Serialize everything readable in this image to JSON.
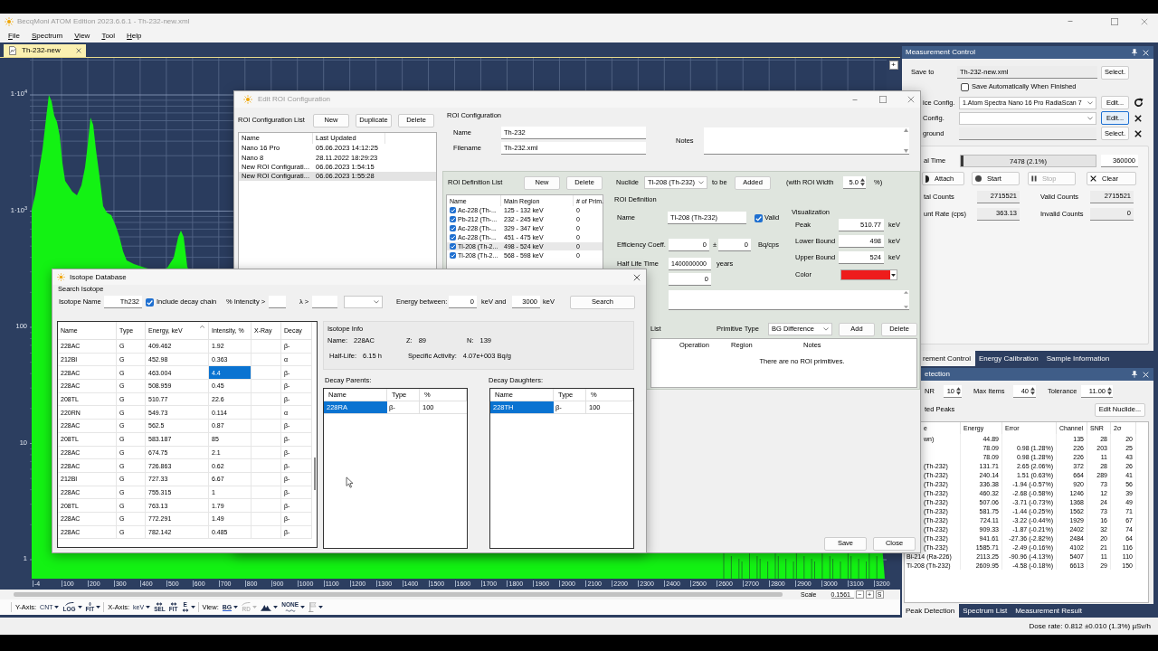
{
  "window": {
    "title": "BecqMoni ATOM Edition 2023.6.6.1 - Th-232-new.xml"
  },
  "menu": [
    {
      "label": "File"
    },
    {
      "label": "Spectrum"
    },
    {
      "label": "View"
    },
    {
      "label": "Tool"
    },
    {
      "label": "Help"
    }
  ],
  "document_tabs": [
    {
      "label": "Th-232-new",
      "selected": true
    }
  ],
  "spectrum": {
    "y_labels": [
      "1·10$^{4}$",
      "1·10$^{3}$",
      "100",
      "10",
      "1"
    ],
    "x_labels": [
      "-4",
      "100",
      "200",
      "300",
      "400",
      "500",
      "600",
      "700",
      "800",
      "900",
      "1000",
      "1100",
      "1200",
      "1300",
      "1400",
      "1500",
      "1600",
      "1700",
      "1800",
      "1900",
      "2000",
      "2100",
      "2200",
      "2300",
      "2400",
      "2500",
      "2600",
      "2700",
      "2800",
      "2900",
      "3000",
      "3100",
      "3200"
    ],
    "zoom_button": "+"
  },
  "roi_dialog": {
    "title": "Edit ROI Configuration",
    "config_list": {
      "label": "ROI Configuration List",
      "buttons": [
        "New",
        "Duplicate",
        "Delete"
      ],
      "columns": [
        "Name",
        "Last Updated"
      ],
      "rows": [
        {
          "name": "Nano 16 Pro",
          "updated": "05.06.2023 14:12:25",
          "selected": false
        },
        {
          "name": "Nano 8",
          "updated": "28.11.2022 18:29:23",
          "selected": false
        },
        {
          "name": "New ROI Configurati...",
          "updated": "06.06.2023 1:54:15",
          "selected": false
        },
        {
          "name": "New ROI Configurati...",
          "updated": "06.06.2023 1:55:28",
          "selected": true
        }
      ]
    },
    "configuration": {
      "label": "ROI Configuration",
      "fields": [
        {
          "label": "Name",
          "value": "Th-232"
        },
        {
          "label": "Filename",
          "value": "Th-232.xml"
        }
      ],
      "notes_label": "Notes"
    },
    "definition_list": {
      "label": "ROI Definition List",
      "buttons": [
        "New",
        "Delete"
      ],
      "columns": [
        "Name",
        "Main Region",
        "# of Prim."
      ],
      "rows": [
        {
          "name": "Ac-228 (Th-...",
          "region": "125 - 132 keV",
          "primitives": "0",
          "checked": true,
          "selected": false
        },
        {
          "name": "Pb-212 (Th-...",
          "region": "232 - 245 keV",
          "primitives": "0",
          "checked": true,
          "selected": false
        },
        {
          "name": "Ac-228 (Th-...",
          "region": "329 - 347 keV",
          "primitives": "0",
          "checked": true,
          "selected": false
        },
        {
          "name": "Ac-228 (Th-...",
          "region": "451 - 475 keV",
          "primitives": "0",
          "checked": true,
          "selected": false
        },
        {
          "name": "Tl-208 (Th-2...",
          "region": "498 - 524 keV",
          "primitives": "0",
          "checked": true,
          "selected": true
        },
        {
          "name": "Tl-208 (Th-2...",
          "region": "568 - 598 keV",
          "primitives": "0",
          "checked": true,
          "selected": false
        }
      ]
    },
    "nuclide": {
      "label": "Nuclide",
      "value": "Tl-208 (Th-232)",
      "to_be": "to be",
      "button": "Added",
      "width_label": "(with ROI Width",
      "width_value": "5.0",
      "width_unit": "%)"
    },
    "definition": {
      "label": "ROI Definition",
      "name_label": "Name",
      "name_value": "Tl-208 (Th-232)",
      "valid": {
        "label": "Valid",
        "checked": true
      },
      "efficiency": {
        "label": "Efficiency Coeff.",
        "value": "0",
        "pm": "±",
        "error": "0",
        "unit": "Bq/cps"
      },
      "half_life": {
        "label": "Half Life Time",
        "value": "1400000000",
        "unit": "years"
      },
      "extra_value": "0"
    },
    "visualization": {
      "label": "Visualization",
      "fields": [
        {
          "label": "Peak",
          "value": "510.77",
          "unit": "keV"
        },
        {
          "label": "Lower Bound",
          "value": "498",
          "unit": "keV"
        },
        {
          "label": "Upper Bound",
          "value": "524",
          "unit": "keV"
        }
      ],
      "color": {
        "label": "Color",
        "color": "#ee1c1c"
      }
    },
    "primitives": {
      "label": "List",
      "type_label": "Primitive Type",
      "type_value": "BG Difference",
      "buttons": [
        "Add",
        "Delete"
      ],
      "columns": [
        "Operation",
        "Region",
        "Notes"
      ],
      "empty": "There are no ROI primitives."
    },
    "footer_buttons": [
      "Save",
      "Close"
    ]
  },
  "isotope_dialog": {
    "title": "Isotope Database",
    "search": {
      "label": "Search Isotope",
      "name_label": "Isotope Name",
      "name_value": "Th232",
      "include_chain": {
        "label": "Include decay chain",
        "checked": true
      },
      "intensity_label": "% Intencity >",
      "lambda_label": "λ >",
      "energy_label": "Energy between:",
      "energy_from": "0",
      "and_label": "keV and",
      "energy_to": "3000",
      "unit": "keV",
      "button": "Search"
    },
    "table": {
      "columns": [
        {
          "label": "Name",
          "sorted": false
        },
        {
          "label": "Type",
          "sorted": false
        },
        {
          "label": "Energy, keV",
          "sorted": true
        },
        {
          "label": "Intensity, %",
          "sorted": false
        },
        {
          "label": "X-Ray",
          "sorted": false
        },
        {
          "label": "Decay",
          "sorted": false
        }
      ],
      "rows": [
        {
          "name": "228AC",
          "type": "G",
          "energy": "409.462",
          "intensity": "1.92",
          "decay": "β-",
          "selected": false
        },
        {
          "name": "212BI",
          "type": "G",
          "energy": "452.98",
          "intensity": "0.363",
          "decay": "α",
          "selected": false
        },
        {
          "name": "228AC",
          "type": "G",
          "energy": "463.004",
          "intensity": "4.4",
          "decay": "β-",
          "selected": true
        },
        {
          "name": "228AC",
          "type": "G",
          "energy": "508.959",
          "intensity": "0.45",
          "decay": "β-",
          "selected": false
        },
        {
          "name": "208TL",
          "type": "G",
          "energy": "510.77",
          "intensity": "22.6",
          "decay": "β-",
          "selected": false
        },
        {
          "name": "220RN",
          "type": "G",
          "energy": "549.73",
          "intensity": "0.114",
          "decay": "α",
          "selected": false
        },
        {
          "name": "228AC",
          "type": "G",
          "energy": "562.5",
          "intensity": "0.87",
          "decay": "β-",
          "selected": false
        },
        {
          "name": "208TL",
          "type": "G",
          "energy": "583.187",
          "intensity": "85",
          "decay": "β-",
          "selected": false
        },
        {
          "name": "228AC",
          "type": "G",
          "energy": "674.75",
          "intensity": "2.1",
          "decay": "β-",
          "selected": false
        },
        {
          "name": "228AC",
          "type": "G",
          "energy": "726.863",
          "intensity": "0.62",
          "decay": "β-",
          "selected": false
        },
        {
          "name": "212BI",
          "type": "G",
          "energy": "727.33",
          "intensity": "6.67",
          "decay": "β-",
          "selected": false
        },
        {
          "name": "228AC",
          "type": "G",
          "energy": "755.315",
          "intensity": "1",
          "decay": "β-",
          "selected": false
        },
        {
          "name": "208TL",
          "type": "G",
          "energy": "763.13",
          "intensity": "1.79",
          "decay": "β-",
          "selected": false
        },
        {
          "name": "228AC",
          "type": "G",
          "energy": "772.291",
          "intensity": "1.49",
          "decay": "β-",
          "selected": false
        },
        {
          "name": "228AC",
          "type": "G",
          "energy": "782.142",
          "intensity": "0.485",
          "decay": "β-",
          "selected": false
        }
      ]
    },
    "info": {
      "label": "Isotope Info",
      "fields": [
        {
          "label": "Name:",
          "value": "228AC"
        },
        {
          "label": "Z:",
          "value": "89"
        },
        {
          "label": "N:",
          "value": "139"
        },
        {
          "label": "Half-Life:",
          "value": "6.15 h"
        },
        {
          "label": "Specific Activity:",
          "value": "4.07e+003 Bq/g"
        }
      ]
    },
    "parents": {
      "label": "Decay Parents:",
      "columns": [
        "Name",
        "Type",
        "%"
      ],
      "rows": [
        {
          "name": "228RA",
          "type": "β-",
          "percent": "100",
          "selected": true
        }
      ]
    },
    "daughters": {
      "label": "Decay Daughters:",
      "columns": [
        "Name",
        "Type",
        "%"
      ],
      "rows": [
        {
          "name": "228TH",
          "type": "β-",
          "percent": "100",
          "selected": true
        }
      ]
    }
  },
  "measurement_control": {
    "title": "Measurement Control",
    "save_to": {
      "label": "Save to",
      "value": "Th-232-new.xml",
      "button": "Select."
    },
    "auto_save": {
      "label": "Save Automatically When Finished",
      "checked": false
    },
    "rows": [
      {
        "kind": "dropdown",
        "label": "ice Config.",
        "value": "1.Atom Spectra Nano 16 Pro RadiaScan 7",
        "button": "Edit...",
        "focused": false
      },
      {
        "kind": "dropdown",
        "label": "Config.",
        "button": "Edit...",
        "focused": true
      },
      {
        "kind": "field",
        "label": "ground",
        "button": "Select.",
        "focused": false
      }
    ],
    "real_time": {
      "label": "al Time",
      "reading": "7478 (2.1%)",
      "level": 0.021,
      "limit": "360000"
    },
    "buttons": [
      {
        "label": "Attach",
        "disabled": false
      },
      {
        "label": "Start",
        "disabled": false
      },
      {
        "label": "Stop",
        "disabled": true
      },
      {
        "label": "Clear",
        "disabled": false
      }
    ],
    "counts": [
      {
        "label": "tal Counts",
        "value": "2715521"
      },
      {
        "label": "Valid Counts",
        "value": "2715521"
      },
      {
        "label": "unt Rate (cps)",
        "value": "363.13"
      },
      {
        "label": "Invalid Counts",
        "value": "0"
      }
    ],
    "tabs": [
      {
        "label": "rement Control",
        "selected": true
      },
      {
        "label": "Energy Calibration",
        "selected": false
      },
      {
        "label": "Sample Information",
        "selected": false
      }
    ]
  },
  "peak_detection": {
    "title": "etection",
    "settings": [
      {
        "label": "NR",
        "value": "10"
      },
      {
        "label": "Max Items",
        "value": "40"
      },
      {
        "label": "Tolerance",
        "value": "11.00"
      }
    ],
    "list_label": "ted Peaks",
    "button": "Edit Nuclide...",
    "columns": [
      "e",
      "Energy",
      "Error",
      "Channel",
      "SNR",
      "2σ"
    ],
    "rows": [
      {
        "name": "wn)",
        "energy": "44.89",
        "channel": "135",
        "snr": "28",
        "sigma2": "20"
      },
      {
        "energy": "78.09",
        "error": "0.98 (1.28%)",
        "channel": "226",
        "snr": "203",
        "sigma2": "25"
      },
      {
        "energy": "78.09",
        "error": "0.98 (1.28%)",
        "channel": "226",
        "snr": "11",
        "sigma2": "43"
      },
      {
        "name": "(Th-232)",
        "energy": "131.71",
        "error": "2.65 (2.06%)",
        "channel": "372",
        "snr": "28",
        "sigma2": "26"
      },
      {
        "name": "(Th-232)",
        "energy": "240.14",
        "error": "1.51 (0.63%)",
        "channel": "664",
        "snr": "289",
        "sigma2": "41"
      },
      {
        "name": "(Th-232)",
        "energy": "336.38",
        "error": "-1.94 (-0.57%)",
        "channel": "920",
        "snr": "73",
        "sigma2": "56"
      },
      {
        "name": "(Th-232)",
        "energy": "460.32",
        "error": "-2.68 (-0.58%)",
        "channel": "1246",
        "snr": "12",
        "sigma2": "39"
      },
      {
        "name": "(Th-232)",
        "energy": "507.06",
        "error": "-3.71 (-0.73%)",
        "channel": "1368",
        "snr": "24",
        "sigma2": "49"
      },
      {
        "name": "(Th-232)",
        "energy": "581.75",
        "error": "-1.44 (-0.25%)",
        "channel": "1562",
        "snr": "73",
        "sigma2": "71"
      },
      {
        "name": "(Th-232)",
        "energy": "724.11",
        "error": "-3.22 (-0.44%)",
        "channel": "1929",
        "snr": "16",
        "sigma2": "67"
      },
      {
        "name": "(Th-232)",
        "energy": "909.33",
        "error": "-1.87 (-0.21%)",
        "channel": "2402",
        "snr": "32",
        "sigma2": "74"
      },
      {
        "name": "(Th-232)",
        "energy": "941.61",
        "error": "-27.36 (-2.82%)",
        "channel": "2484",
        "snr": "20",
        "sigma2": "64"
      },
      {
        "name": "(Th-232)",
        "energy": "1585.71",
        "error": "-2.49 (-0.16%)",
        "channel": "4102",
        "snr": "21",
        "sigma2": "116"
      },
      {
        "name": "Bi-214 (Ra-226)",
        "energy": "2113.25",
        "error": "-90.96 (-4.13%)",
        "channel": "5407",
        "snr": "11",
        "sigma2": "110"
      },
      {
        "name": "Tl-208 (Th-232)",
        "energy": "2609.95",
        "error": "-4.58 (-0.18%)",
        "channel": "6613",
        "snr": "29",
        "sigma2": "150"
      }
    ],
    "tabs": [
      {
        "label": "Peak Detection",
        "selected": true
      },
      {
        "label": "Spectrum List",
        "selected": false
      },
      {
        "label": "Measurement Result",
        "selected": false
      }
    ]
  },
  "scale": {
    "label": "Scale",
    "value": "0.1561",
    "buttons": [
      "−",
      "+",
      "S"
    ]
  },
  "toolbar": {
    "groups": [
      {
        "label": "Y-Axis:",
        "tools": [
          {
            "kind": "text",
            "text": "CNT",
            "dropdown": true,
            "disabled": false
          },
          {
            "kind": "curve",
            "text": "LOG",
            "dropdown": true,
            "disabled": false
          },
          {
            "kind": "vfit",
            "text": "FIT",
            "dropdown": true,
            "disabled": false
          }
        ]
      },
      {
        "label": "X-Axis:",
        "tools": [
          {
            "kind": "text",
            "text": "keV",
            "dropdown": true,
            "disabled": false
          },
          {
            "kind": "arrows",
            "text": "SEL",
            "dropdown": false,
            "disabled": false
          },
          {
            "kind": "arrows",
            "text": "FIT",
            "dropdown": false,
            "disabled": false
          },
          {
            "kind": "arrows-below",
            "text": "E",
            "dropdown": true,
            "disabled": false
          }
        ]
      },
      {
        "label": "View:",
        "tools": [
          {
            "kind": "underlined",
            "text": "BG",
            "dropdown": true,
            "disabled": false
          },
          {
            "kind": "curve",
            "text": "RD",
            "dropdown": true,
            "disabled": true
          },
          {
            "kind": "peaks",
            "dropdown": true,
            "disabled": false
          },
          {
            "kind": "wave",
            "text": "NONE",
            "dropdown": true,
            "disabled": false
          },
          {
            "kind": "flag",
            "dropdown": true,
            "disabled": false
          }
        ]
      }
    ]
  },
  "status_bar": {
    "dose_rate": "Dose rate: 0.812 ±0.010 (1.3%) µSv/h"
  }
}
